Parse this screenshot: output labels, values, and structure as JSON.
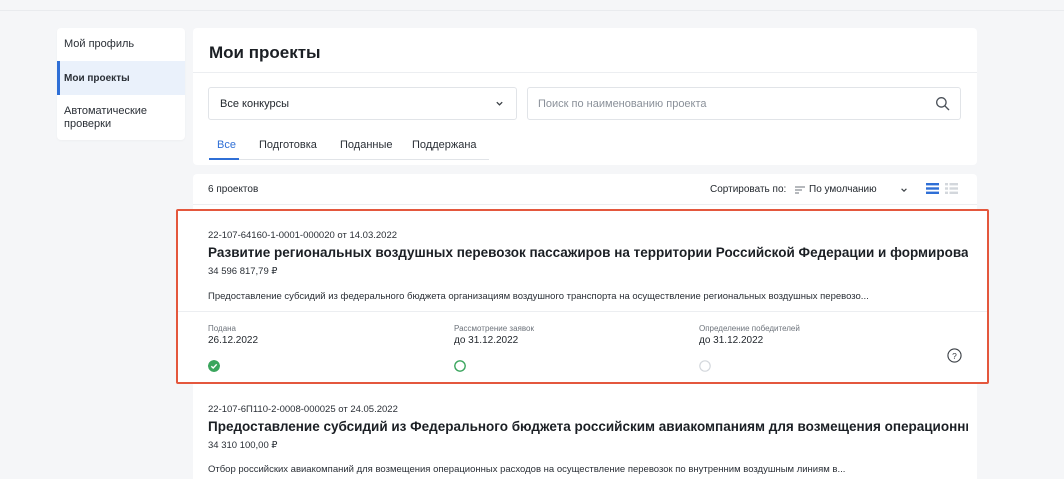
{
  "sidebar": {
    "items": [
      {
        "label": "Мой профиль"
      },
      {
        "label": "Мои проекты"
      },
      {
        "label": "Автоматические проверки"
      }
    ]
  },
  "header": {
    "title": "Мои проекты",
    "contest_select": "Все конкурсы",
    "search_placeholder": "Поиск по наименованию проекта",
    "tabs": [
      {
        "label": "Все"
      },
      {
        "label": "Подготовка"
      },
      {
        "label": "Поданные"
      },
      {
        "label": "Поддержана"
      }
    ]
  },
  "list": {
    "count": "6 проектов",
    "sort_label": "Сортировать по:",
    "sort_value": "По умолчанию",
    "projects": [
      {
        "id_line": "22-107-64160-1-0001-000020 от 14.03.2022",
        "title": "Развитие региональных воздушных перевозок пассажиров на территории Российской Федерации и формировани...",
        "sum": "34 596 817,79 ₽",
        "description": "Предоставление субсидий из федерального бюджета организациям воздушного транспорта на осуществление региональных воздушных перевозо...",
        "stages": [
          {
            "label": "Подана",
            "date": "26.12.2022",
            "status": "done"
          },
          {
            "label": "Рассмотрение заявок",
            "date": "до 31.12.2022",
            "status": "current"
          },
          {
            "label": "Определение победителей",
            "date": "до 31.12.2022",
            "status": "pending"
          }
        ]
      },
      {
        "id_line": "22-107-6П110-2-0008-000025 от 24.05.2022",
        "title": "Предоставление субсидий из Федерального бюджета российским авиакомпаниям для возмещения операционны...",
        "sum": "34 310 100,00 ₽",
        "description": "Отбор российских авиакомпаний для возмещения операционных расходов на осуществление перевозок по внутренним воздушным линиям в..."
      }
    ]
  },
  "colors": {
    "accent": "#2f6fd6",
    "highlight_border": "#e4573d",
    "done": "#3aa55d"
  }
}
